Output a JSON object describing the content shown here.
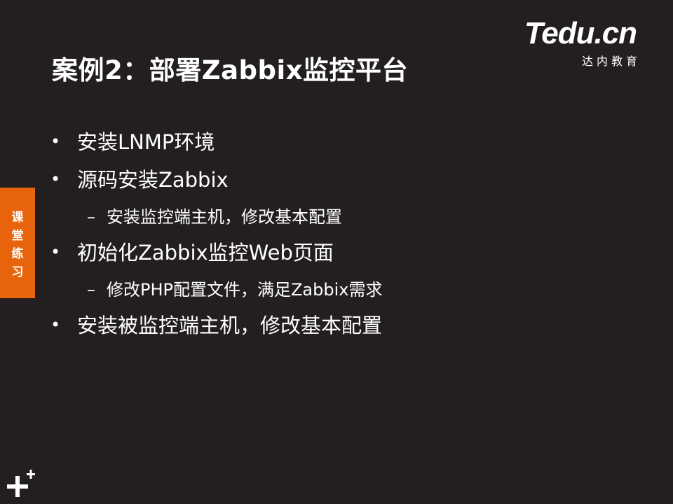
{
  "slide": {
    "title": "案例2：部署Zabbix监控平台",
    "logo": {
      "wordmark": "Tedu.cn",
      "subtitle": "达内教育"
    },
    "side_tab": [
      "课",
      "堂",
      "练",
      "习"
    ],
    "bullets": [
      {
        "level": 1,
        "text": "安装LNMP环境"
      },
      {
        "level": 1,
        "text": "源码安装Zabbix"
      },
      {
        "level": 2,
        "text": "安装监控端主机，修改基本配置"
      },
      {
        "level": 1,
        "text": "初始化Zabbix监控Web页面"
      },
      {
        "level": 2,
        "text": "修改PHP配置文件，满足Zabbix需求"
      },
      {
        "level": 1,
        "text": "安装被监控端主机，修改基本配置"
      }
    ],
    "bullet_symbols": {
      "level1": "•",
      "level2": "–"
    },
    "colors": {
      "background": "#231f20",
      "accent": "#e8640c",
      "brand": "#e6007e",
      "text": "#ffffff"
    },
    "icons": {
      "corner": "plus-plus-icon"
    }
  }
}
